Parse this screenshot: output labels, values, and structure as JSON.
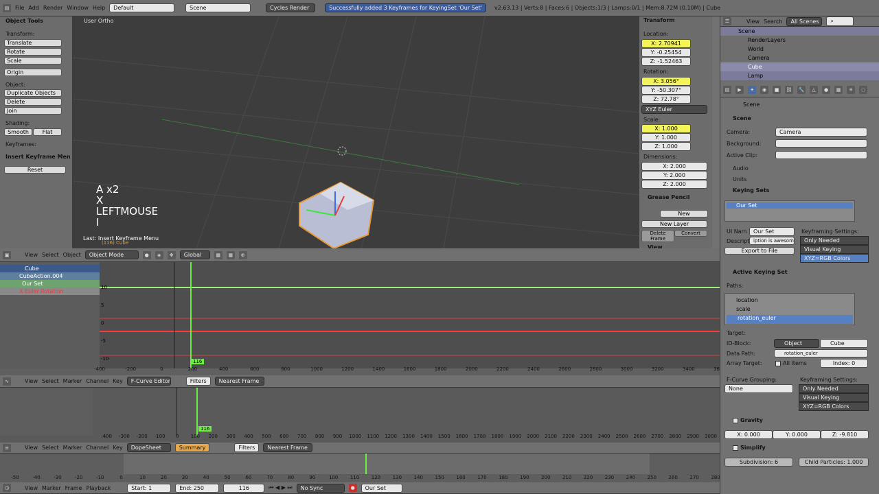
{
  "topbar": {
    "menus": [
      "File",
      "Add",
      "Render",
      "Window",
      "Help"
    ],
    "layout": "Default",
    "scene": "Scene",
    "engine": "Cycles Render",
    "message": "Successfully added 3 Keyframes for KeyingSet 'Our Set'",
    "stats": "v2.63.13 | Verts:8 | Faces:6 | Objects:1/3 | Lamps:0/1 | Mem:8.72M (0.10M) | Cube"
  },
  "toolshelf": {
    "title": "Object Tools",
    "transform_label": "Transform:",
    "buttons": [
      "Translate",
      "Rotate",
      "Scale"
    ],
    "origin": "Origin",
    "object_label": "Object:",
    "object_buttons": [
      "Duplicate Objects",
      "Delete",
      "Join"
    ],
    "shading_label": "Shading:",
    "smooth": "Smooth",
    "flat": "Flat",
    "keyframes_label": "Keyframes:",
    "op_title": "Insert Keyframe Men",
    "reset": "Reset"
  },
  "viewport": {
    "label": "User Ortho",
    "keys": [
      "A x2",
      "X",
      "LEFTMOUSE",
      "I"
    ],
    "last_op": "Last: Insert Keyframe Menu",
    "obj_label": "(116) Cube"
  },
  "transform": {
    "title": "Transform",
    "location_label": "Location:",
    "location": [
      "X: 2.70941",
      "Y: -0.25454",
      "Z: -1.52463"
    ],
    "rotation_label": "Rotation:",
    "rotation": [
      "X: 3.056°",
      "Y: -50.307°",
      "Z: 72.78°"
    ],
    "rotation_mode": "XYZ Euler",
    "scale_label": "Scale:",
    "scale": [
      "X: 1.000",
      "Y: 1.000",
      "Z: 1.000"
    ],
    "dimensions_label": "Dimensions:",
    "dimensions": [
      "X: 2.000",
      "Y: 2.000",
      "Z: 2.000"
    ],
    "grease_title": "Grease Pencil",
    "new": "New",
    "new_layer": "New Layer",
    "delete_frame": "Delete Frame",
    "convert": "Convert",
    "view_title": "View"
  },
  "view3d_header": {
    "menus": [
      "View",
      "Select",
      "Object"
    ],
    "mode": "Object Mode",
    "orientation": "Global"
  },
  "fcurve": {
    "channels": [
      "Cube",
      "CubeAction.004",
      "Our Set",
      "X Euler Rotation"
    ],
    "frame_badge": "116",
    "ticks": [
      "-400",
      "-200",
      "0",
      "200",
      "400",
      "600",
      "800",
      "1000",
      "1200",
      "1400",
      "1600",
      "1800",
      "2000",
      "2200",
      "2400",
      "2600",
      "2800",
      "3000",
      "3200",
      "3400",
      "3600"
    ],
    "vticks": [
      "10",
      "5",
      "0",
      "-5",
      "-10"
    ],
    "menus": [
      "View",
      "Select",
      "Marker",
      "Channel",
      "Key"
    ],
    "editor": "F-Curve Editor",
    "filters": "Filters",
    "snap": "Nearest Frame"
  },
  "nla": {
    "frame_badge": "116",
    "ticks": [
      "-400",
      "-300",
      "-200",
      "-100",
      "0",
      "100",
      "200",
      "300",
      "400",
      "500",
      "600",
      "700",
      "800",
      "900",
      "1000",
      "1100",
      "1200",
      "1300",
      "1400",
      "1500",
      "1600",
      "1700",
      "1800",
      "1900",
      "2000",
      "2100",
      "2200",
      "2300",
      "2400",
      "2500",
      "2600",
      "2700",
      "2800",
      "2900",
      "3000"
    ]
  },
  "dopesheet": {
    "menus": [
      "View",
      "Select",
      "Marker",
      "Channel",
      "Key"
    ],
    "mode": "DopeSheet",
    "summary": "Summary",
    "filters": "Filters",
    "snap": "Nearest Frame",
    "ticks": [
      "-50",
      "-40",
      "-30",
      "-20",
      "-10",
      "0",
      "10",
      "20",
      "30",
      "40",
      "50",
      "60",
      "70",
      "80",
      "90",
      "100",
      "110",
      "120",
      "130",
      "140",
      "150",
      "160",
      "170",
      "180",
      "190",
      "200",
      "210",
      "220",
      "230",
      "240",
      "250",
      "260",
      "270",
      "280"
    ]
  },
  "timeline": {
    "menus": [
      "View",
      "Marker",
      "Frame",
      "Playback"
    ],
    "start": "Start: 1",
    "end": "End: 250",
    "current": "116",
    "sync": "No Sync",
    "keyset": "Our Set"
  },
  "outliner": {
    "menus": [
      "View",
      "Search"
    ],
    "filter": "All Scenes",
    "items": [
      "Scene",
      "RenderLayers",
      "World",
      "Camera",
      "Cube",
      "Lamp"
    ]
  },
  "properties": {
    "breadcrumb": "Scene",
    "scene_title": "Scene",
    "camera_label": "Camera:",
    "camera": "Camera",
    "background_label": "Background:",
    "clip_label": "Active Clip:",
    "audio": "Audio",
    "units": "Units",
    "keying_sets": "Keying Sets",
    "set_name": "Our Set",
    "ui_name_label": "UI Nam",
    "ui_name": "Our Set",
    "desc_label": "Descript",
    "desc": "iption is awesome",
    "export": "Export to File",
    "kf_settings_label": "Keyframing Settings:",
    "kf_options": [
      "Only Needed",
      "Visual Keying",
      "XYZ=RGB Colors"
    ],
    "active_keying": "Active Keying Set",
    "paths_label": "Paths:",
    "paths": [
      "location",
      "scale",
      "rotation_euler"
    ],
    "target_label": "Target:",
    "idblock_label": "ID-Block:",
    "idblock": "Object",
    "idname": "Cube",
    "datapath_label": "Data Path:",
    "datapath": "rotation_euler",
    "array_label": "Array Target:",
    "all_items": "All Items",
    "index": "Index: 0",
    "grouping_label": "F-Curve Grouping:",
    "grouping": "None",
    "kf_options2": [
      "Only Needed",
      "Visual Keying",
      "XYZ=RGB Colors"
    ],
    "gravity": "Gravity",
    "gravity_vals": [
      "X: 0.000",
      "Y: 0.000",
      "Z: -9.810"
    ],
    "simplify": "Simplify",
    "subdivision": "Subdivision: 6",
    "child": "Child Particles: 1.000"
  }
}
